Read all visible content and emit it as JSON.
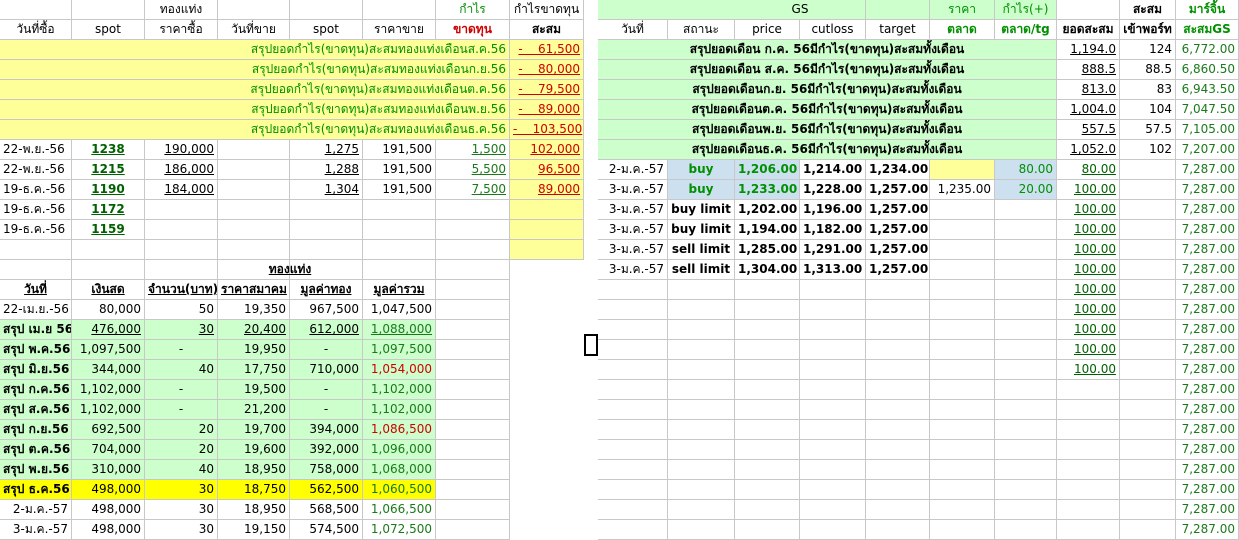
{
  "left": {
    "header1": [
      "",
      "",
      "ทองแท่ง",
      "",
      "",
      "",
      "กำไร",
      "กำไรขาดทุน"
    ],
    "header2": [
      "วันที่ซื้อ",
      "spot",
      "ราคาซื้อ",
      "วันที่ขาย",
      "spot",
      "ราคาขาย",
      "ขาดทุน",
      "สะสม"
    ],
    "summary_rows": [
      {
        "label": "สรุปยอดกำไร(ขาดทุน)สะสมทองแท่งเดือนส.ค.56",
        "value": "61,500"
      },
      {
        "label": "สรุปยอดกำไร(ขาดทุน)สะสมทองแท่งเดือนก.ย.56",
        "value": "80,000"
      },
      {
        "label": "สรุปยอดกำไร(ขาดทุน)สะสมทองแท่งเดือนต.ค.56",
        "value": "79,500"
      },
      {
        "label": "สรุปยอดกำไร(ขาดทุน)สะสมทองแท่งเดือนพ.ย.56",
        "value": "89,000"
      },
      {
        "label": "สรุปยอดกำไร(ขาดทุน)สะสมทองแท่งเดือนธ.ค.56",
        "value": "103,500"
      }
    ],
    "trade_rows": [
      [
        "22-พ.ย.-56",
        "1238",
        "190,000",
        "",
        "1,275",
        "191,500",
        "1,500",
        "102,000"
      ],
      [
        "22-พ.ย.-56",
        "1215",
        "186,000",
        "",
        "1,288",
        "191,500",
        "5,500",
        "96,500"
      ],
      [
        "19-ธ.ค.-56",
        "1190",
        "184,000",
        "",
        "1,304",
        "191,500",
        "7,500",
        "89,000"
      ],
      [
        "19-ธ.ค.-56",
        "1172",
        "",
        "",
        "",
        "",
        "",
        ""
      ],
      [
        "19-ธ.ค.-56",
        "1159",
        "",
        "",
        "",
        "",
        "",
        ""
      ]
    ],
    "gold_title": "ทองแท่ง",
    "gold_header": [
      "วันที่",
      "เงินสด",
      "จำนวน(บาท)",
      "ราคาสมาคม",
      "มูลค่าทอง",
      "มูลค่ารวม"
    ],
    "gold_rows": [
      [
        "22-เม.ย.-56",
        "80,000",
        "50",
        "19,350",
        "967,500",
        "1,047,500"
      ],
      [
        "สรุป เม.ย 56",
        "476,000",
        "30",
        "20,400",
        "612,000",
        "1,088,000"
      ],
      [
        "สรุป พ.ค.56",
        "1,097,500",
        "-",
        "19,950",
        "-",
        "1,097,500"
      ],
      [
        "สรุป มิ.ย.56",
        "344,000",
        "40",
        "17,750",
        "710,000",
        "1,054,000"
      ],
      [
        "สรุป ก.ค.56",
        "1,102,000",
        "-",
        "19,500",
        "-",
        "1,102,000"
      ],
      [
        "สรุป ส.ค.56",
        "1,102,000",
        "-",
        "21,200",
        "-",
        "1,102,000"
      ],
      [
        "สรุป ก.ย.56",
        "692,500",
        "20",
        "19,700",
        "394,000",
        "1,086,500"
      ],
      [
        "สรุป ต.ค.56",
        "704,000",
        "20",
        "19,600",
        "392,000",
        "1,096,000"
      ],
      [
        "สรุป พ.ย.56",
        "310,000",
        "40",
        "18,950",
        "758,000",
        "1,068,000"
      ],
      [
        "สรุป ธ.ค.56",
        "498,000",
        "30",
        "18,750",
        "562,500",
        "1,060,500"
      ],
      [
        "2-ม.ค.-57",
        "498,000",
        "30",
        "18,950",
        "568,500",
        "1,066,500"
      ],
      [
        "3-ม.ค.-57",
        "498,000",
        "30",
        "19,150",
        "574,500",
        "1,072,500"
      ]
    ]
  },
  "right": {
    "header1": [
      "",
      "",
      "GS",
      "",
      "",
      "ราคา",
      "กำไร(+)",
      "",
      "สะสม",
      "มาร์จิ้น"
    ],
    "header2": [
      "วันที่",
      "สถานะ",
      "price",
      "cutloss",
      "target",
      "ตลาด",
      "ตลาด/tg",
      "ยอดสะสม",
      "เข้าพอร์ท",
      "สะสมGS"
    ],
    "summary_rows": [
      {
        "label": "สรุปยอดเดือน ก.ค. 56มีกำไร(ขาดทุน)สะสมทั้งเดือน",
        "total": "1,194.0",
        "port": "124",
        "gs": "6,772.00"
      },
      {
        "label": "สรุปยอดเดือน ส.ค. 56มีกำไร(ขาดทุน)สะสมทั้งเดือน",
        "total": "888.5",
        "port": "88.5",
        "gs": "6,860.50"
      },
      {
        "label": "สรุปยอดเดือนก.ย. 56มีกำไร(ขาดทุน)สะสมทั้งเดือน",
        "total": "813.0",
        "port": "83",
        "gs": "6,943.50"
      },
      {
        "label": "สรุปยอดเดือนต.ค. 56มีกำไร(ขาดทุน)สะสมทั้งเดือน",
        "total": "1,004.0",
        "port": "104",
        "gs": "7,047.50"
      },
      {
        "label": "สรุปยอดเดือนพ.ย. 56มีกำไร(ขาดทุน)สะสมทั้งเดือน",
        "total": "557.5",
        "port": "57.5",
        "gs": "7,105.00"
      },
      {
        "label": "สรุปยอดเดือนธ.ค. 56มีกำไร(ขาดทุน)สะสมทั้งเดือน",
        "total": "1,052.0",
        "port": "102",
        "gs": "7,207.00"
      }
    ],
    "trade_rows": [
      [
        "2-ม.ค.-57",
        "buy",
        "1,206.00",
        "1,214.00",
        "1,234.00",
        "",
        "80.00",
        "80.00",
        "",
        "7,287.00"
      ],
      [
        "3-ม.ค.-57",
        "buy",
        "1,233.00",
        "1,228.00",
        "1,257.00",
        "1,235.00",
        "20.00",
        "100.00",
        "",
        "7,287.00"
      ],
      [
        "3-ม.ค.-57",
        "buy limit",
        "1,202.00",
        "1,196.00",
        "1,257.00",
        "",
        "",
        "100.00",
        "",
        "7,287.00"
      ],
      [
        "3-ม.ค.-57",
        "buy limit",
        "1,194.00",
        "1,182.00",
        "1,257.00",
        "",
        "",
        "100.00",
        "",
        "7,287.00"
      ],
      [
        "3-ม.ค.-57",
        "sell limit",
        "1,285.00",
        "1,291.00",
        "1,257.00",
        "",
        "",
        "100.00",
        "",
        "7,287.00"
      ],
      [
        "3-ม.ค.-57",
        "sell limit",
        "1,304.00",
        "1,313.00",
        "1,257.00",
        "",
        "",
        "100.00",
        "",
        "7,287.00"
      ]
    ],
    "tail_totals": [
      "100.00",
      "100.00",
      "100.00",
      "100.00",
      "100.00",
      "",
      "",
      "",
      "",
      "",
      "",
      "",
      ""
    ],
    "tail_gs": "7,287.00"
  }
}
